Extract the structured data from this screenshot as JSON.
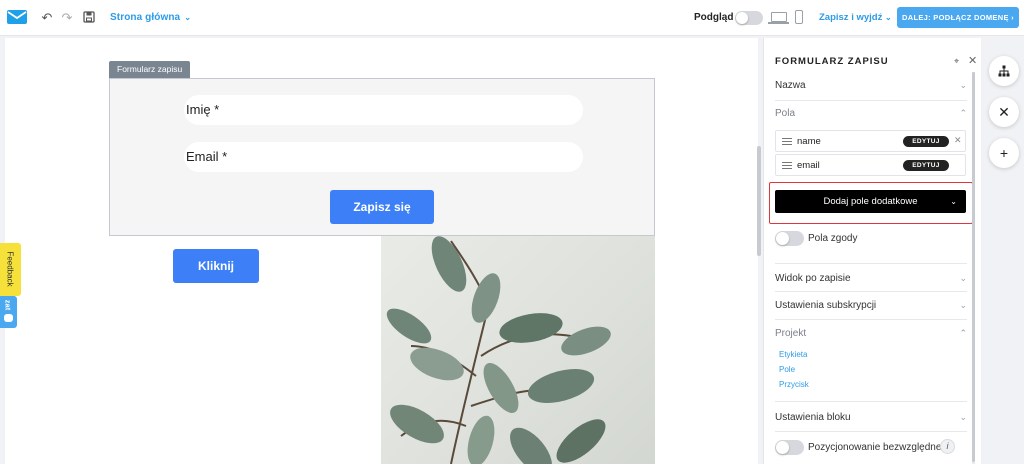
{
  "topbar": {
    "page_select": "Strona główna",
    "preview_label": "Podgląd",
    "save_exit": "Zapisz i wyjdź",
    "next_button": "DALEJ: PODŁĄCZ DOMENĘ"
  },
  "canvas": {
    "form_tag": "Formularz zapisu",
    "fields": [
      "Imię *",
      "Email *"
    ],
    "submit_label": "Zapisz się",
    "click_label": "Kliknij"
  },
  "side_tabs": {
    "feedback": "Feedback",
    "chat": "zat"
  },
  "panel": {
    "title": "FORMULARZ ZAPISU",
    "sections": {
      "name": "Nazwa",
      "fields": "Pola",
      "after_signup": "Widok po zapisie",
      "subscription": "Ustawienia subskrypcji",
      "design": "Projekt",
      "block": "Ustawienia bloku"
    },
    "field_rows": [
      {
        "name": "name",
        "edit": "EDYTUJ"
      },
      {
        "name": "email",
        "edit": "EDYTUJ"
      }
    ],
    "add_field": "Dodaj pole dodatkowe",
    "consent_label": "Pola zgody",
    "design_links": [
      "Etykieta",
      "Pole",
      "Przycisk"
    ],
    "absolute_position": "Pozycjonowanie bezwzględne",
    "info": "i"
  },
  "colors": {
    "accent": "#3d7ff6",
    "link": "#2e9be6",
    "highlight": "#e0353d"
  }
}
